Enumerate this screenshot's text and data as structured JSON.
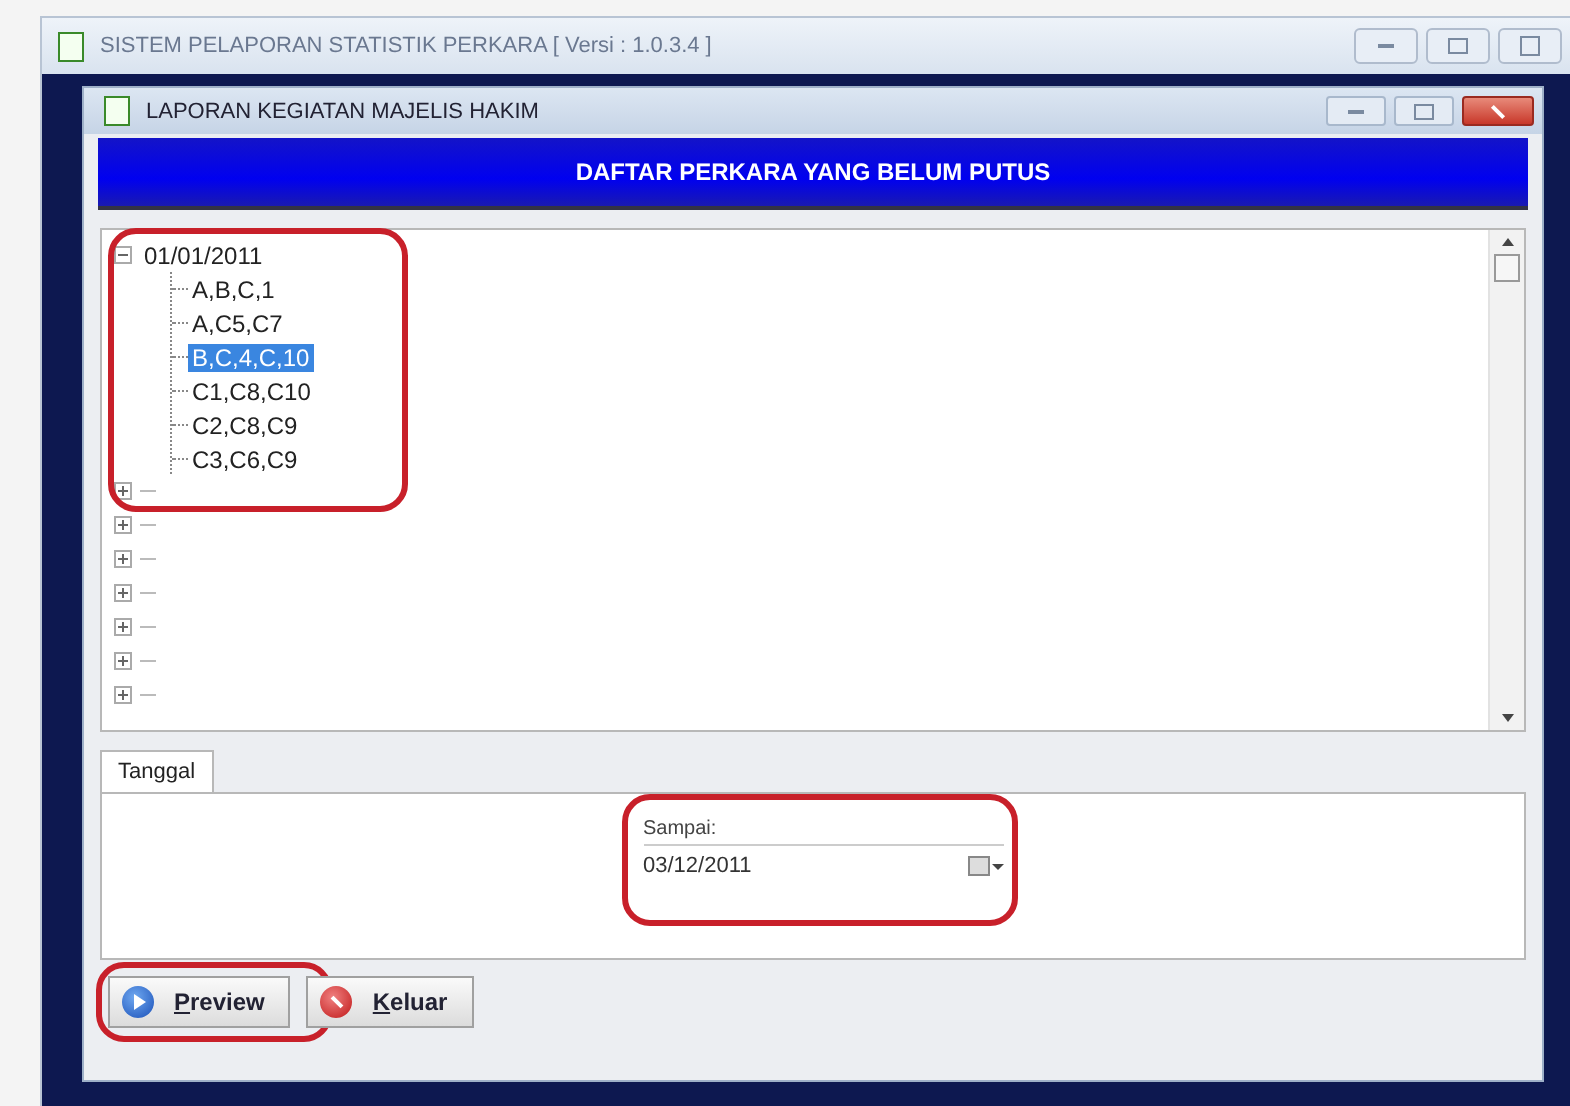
{
  "app_window": {
    "title": "SISTEM PELAPORAN STATISTIK PERKARA [ Versi : 1.0.3.4 ]"
  },
  "dialog": {
    "title": "LAPORAN KEGIATAN MAJELIS HAKIM",
    "banner": "DAFTAR PERKARA YANG BELUM PUTUS"
  },
  "tree": {
    "highlighted": true,
    "nodes": [
      {
        "label": "01/01/2011",
        "expanded": true,
        "children": [
          {
            "label": "A,B,C,1",
            "selected": false
          },
          {
            "label": "A,C5,C7",
            "selected": false
          },
          {
            "label": "B,C,4,C,10",
            "selected": true
          },
          {
            "label": "C1,C8,C10",
            "selected": false
          },
          {
            "label": "C2,C8,C9",
            "selected": false
          },
          {
            "label": "C3,C6,C9",
            "selected": false
          }
        ]
      },
      {
        "expanded": false
      },
      {
        "expanded": false
      },
      {
        "expanded": false
      },
      {
        "expanded": false
      },
      {
        "expanded": false
      },
      {
        "expanded": false
      },
      {
        "expanded": false
      }
    ]
  },
  "tabs": [
    {
      "label": "Tanggal",
      "selected": true
    }
  ],
  "date_field": {
    "label": "Sampai:",
    "value": "03/12/2011",
    "highlighted": true
  },
  "buttons": [
    {
      "label": "Preview",
      "kind": "preview",
      "highlighted": true
    },
    {
      "label": "Keluar",
      "kind": "exit"
    }
  ]
}
